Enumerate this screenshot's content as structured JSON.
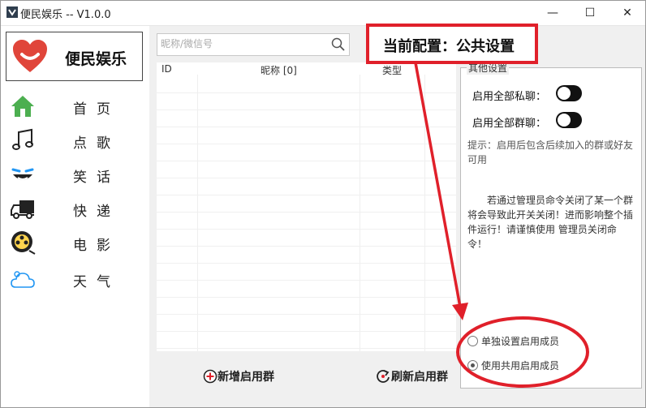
{
  "window": {
    "title": "便民娱乐 -- V1.0.0",
    "controls": [
      "—",
      "☐",
      "✕"
    ]
  },
  "brand": {
    "name": "便民娱乐"
  },
  "nav": [
    {
      "label": "首页",
      "icon": "home-icon"
    },
    {
      "label": "点歌",
      "icon": "music-note-icon"
    },
    {
      "label": "笑话",
      "icon": "laugh-face-icon"
    },
    {
      "label": "快递",
      "icon": "truck-icon"
    },
    {
      "label": "电影",
      "icon": "film-reel-icon"
    },
    {
      "label": "天气",
      "icon": "cloud-weather-icon"
    }
  ],
  "search": {
    "placeholder": "昵称/微信号"
  },
  "table": {
    "columns": [
      "ID",
      "昵称 [0]",
      "类型"
    ]
  },
  "buttons": {
    "add_group": "新增启用群",
    "refresh_group": "刷新启用群"
  },
  "settings": {
    "group_title": "其他设置",
    "toggle_private": "启用全部私聊：",
    "toggle_group": "启用全部群聊：",
    "hint": "提示：启用后包含后续加入的群或好友可用",
    "warning": "若通过管理员命令关闭了某一个群将会导致此开关关闭！进而影响整个插件运行！请谨慎使用 管理员关闭命令！",
    "radio_single": "单独设置启用成员",
    "radio_shared": "使用共用启用成员"
  },
  "annotation": {
    "callout": "当前配置：公共设置"
  },
  "colors": {
    "accent_red": "#e0202a",
    "brand_red": "#e0453a",
    "home_green": "#4caf50"
  }
}
